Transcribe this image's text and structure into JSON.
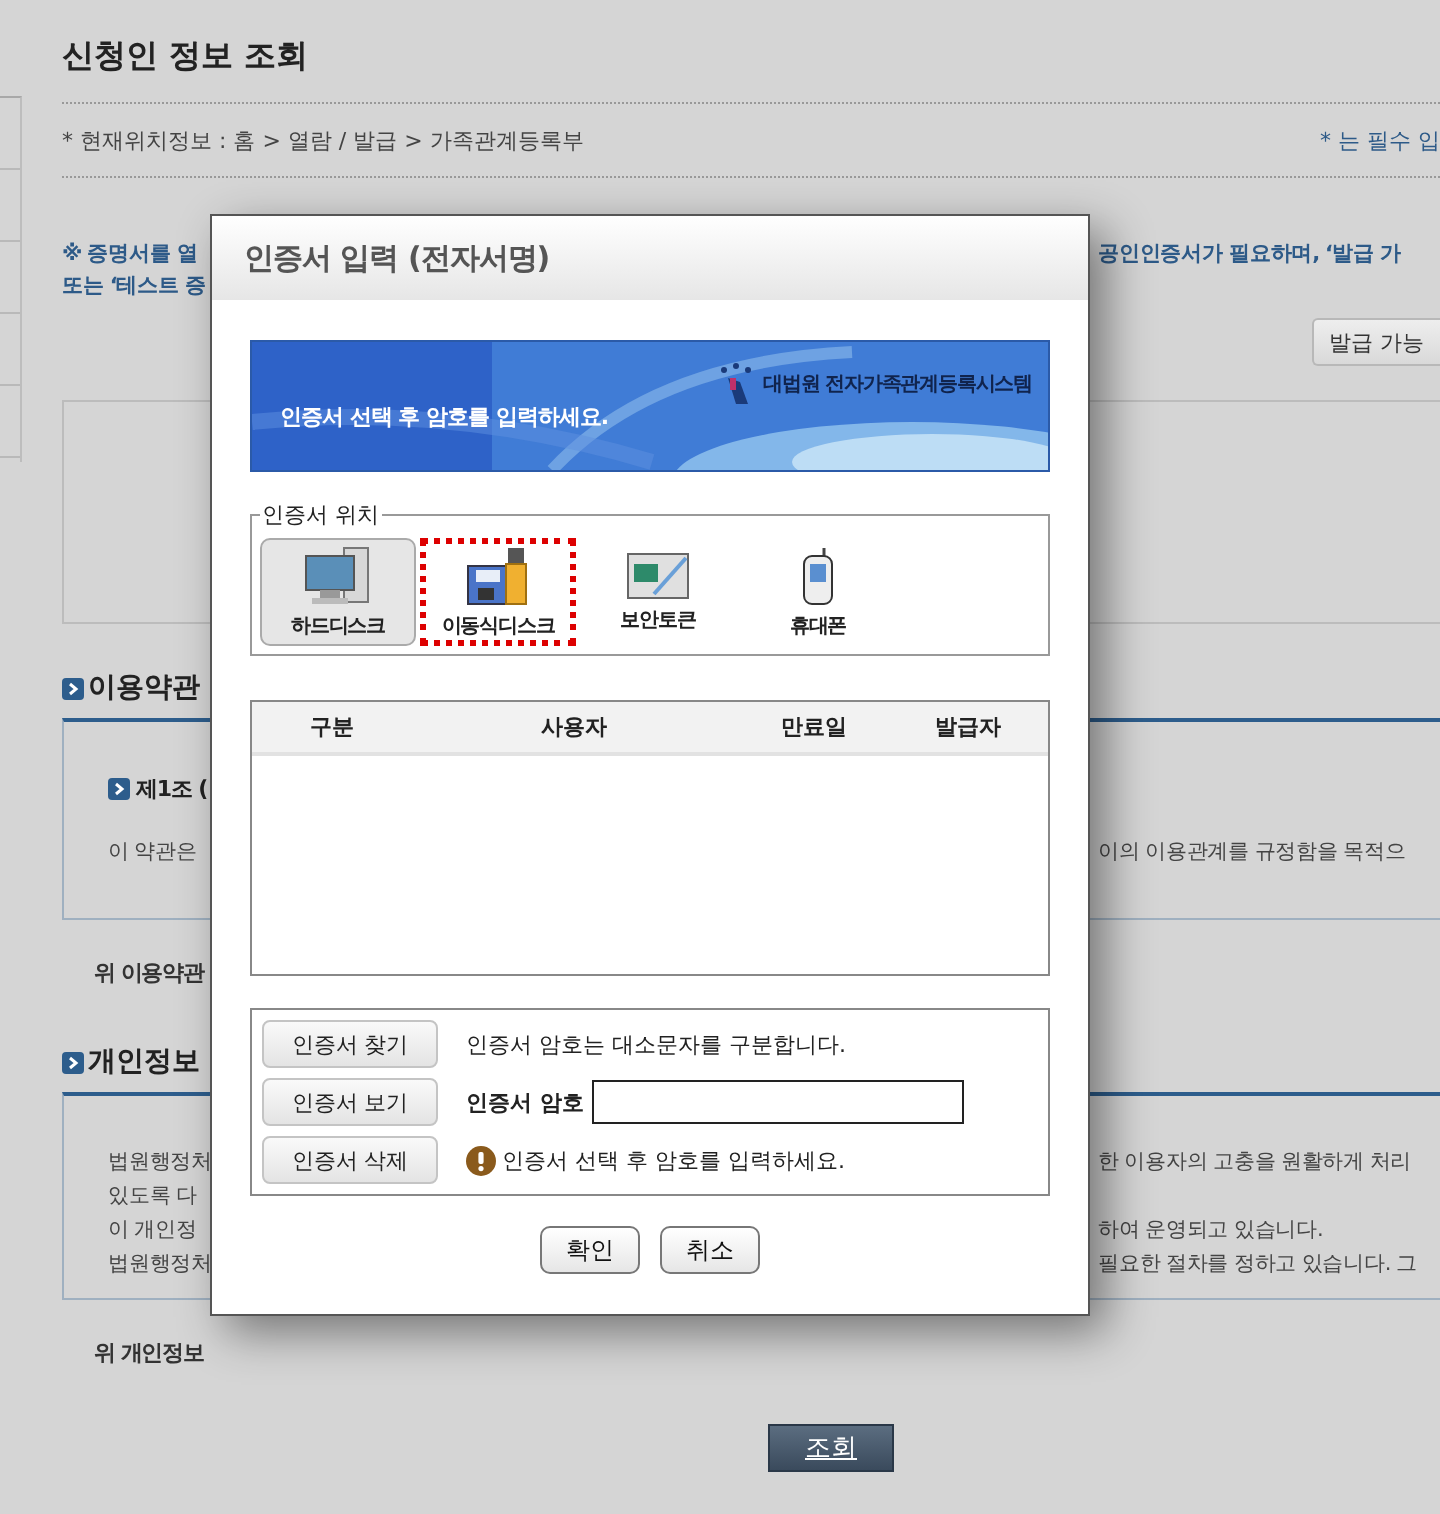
{
  "page": {
    "title": "신청인 정보 조회",
    "breadcrumb": "* 현재위치정보 : 홈 > 열람 / 발급 > 가족관계등록부",
    "required_note": "* 는 필수 입",
    "notice_lines": [
      {
        "left": "※ 증명서를 열",
        "right": "**공인인증서가 필요**하며, ‘발급 가"
      },
      {
        "left": "또는 ‘테스트 증"
      }
    ],
    "issue_button": "발급 가능",
    "terms": {
      "heading": "이용약관",
      "article": "제1조 (",
      "line": {
        "left": "이 약관은",
        "right": "이의 이용관계를 규정함을 목적으"
      },
      "agree": "위 이용약관"
    },
    "privacy": {
      "heading": "개인정보",
      "lines": [
        {
          "left": "법원행정처",
          "right": "한 이용자의 고충을 원활하게 처리"
        },
        {
          "left": "있도록 다"
        },
        {
          "left": "이 개인정",
          "right": "하여 운영되고 있습니다."
        },
        {
          "left": "법원행정처",
          "right": "필요한 절차를 정하고 있습니다. 그"
        }
      ],
      "agree": "위 개인정보"
    },
    "search_button": "조회"
  },
  "dialog": {
    "title": "인증서 입력 (전자서명)",
    "banner": {
      "message": "인증서 선택 후 암호를 입력하세요.",
      "system": "대법원 전자가족관계등록시스템"
    },
    "location": {
      "legend": "인증서 위치",
      "devices": [
        {
          "kind": "hdd",
          "label": "하드디스크",
          "selected": true,
          "highlighted": false
        },
        {
          "kind": "removable",
          "label": "이동식디스크",
          "selected": false,
          "highlighted": true
        },
        {
          "kind": "token",
          "label": "보안토큰",
          "selected": false,
          "highlighted": false
        },
        {
          "kind": "phone",
          "label": "휴대폰",
          "selected": false,
          "highlighted": false
        }
      ]
    },
    "table": {
      "columns": [
        "구분",
        "사용자",
        "만료일",
        "발급자"
      ]
    },
    "actions": [
      {
        "kind": "note",
        "button": "인증서 찾기",
        "text": "인증서 암호는 대소문자를 구분합니다."
      },
      {
        "kind": "password",
        "button": "인증서 보기",
        "text": "인증서 암호"
      },
      {
        "kind": "warning",
        "button": "인증서 삭제",
        "text": "인증서 선택 후 암호를 입력하세요."
      }
    ],
    "buttons": [
      "확인",
      "취소"
    ]
  }
}
